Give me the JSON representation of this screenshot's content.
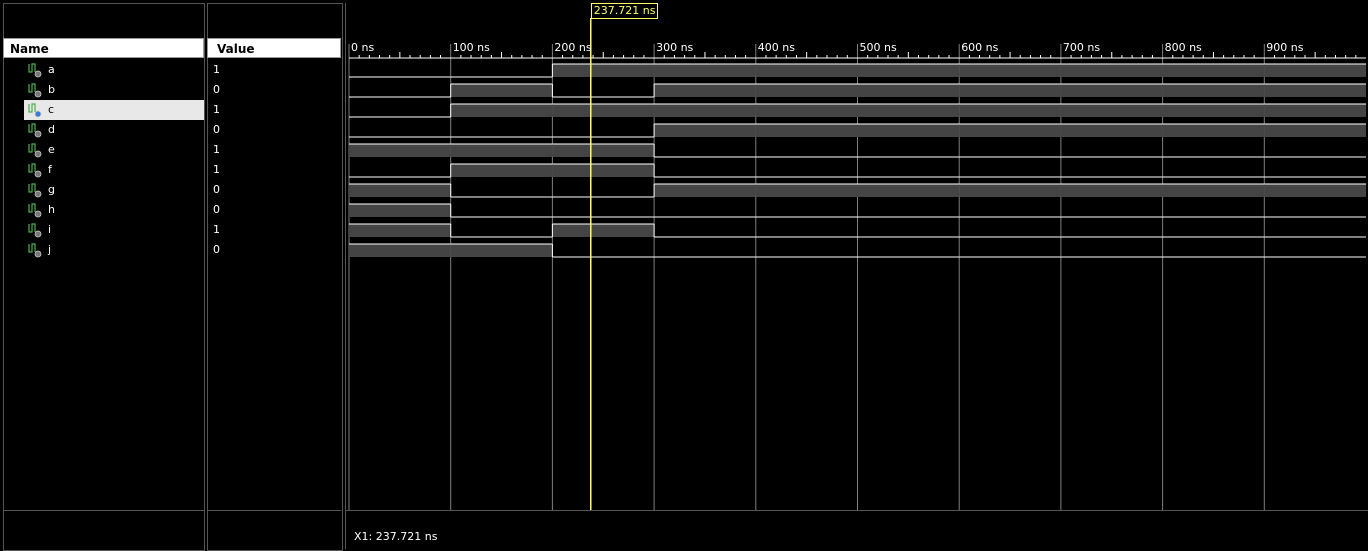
{
  "columns": {
    "name_header": "Name",
    "value_header": "Value"
  },
  "signals": [
    {
      "name": "a",
      "value": "1",
      "wave": [
        0,
        0,
        1,
        1,
        1,
        1,
        1,
        1,
        1,
        1
      ]
    },
    {
      "name": "b",
      "value": "0",
      "wave": [
        0,
        1,
        0,
        1,
        1,
        1,
        1,
        1,
        1,
        1
      ]
    },
    {
      "name": "c",
      "value": "1",
      "wave": [
        0,
        1,
        1,
        1,
        1,
        1,
        1,
        1,
        1,
        1
      ]
    },
    {
      "name": "d",
      "value": "0",
      "wave": [
        0,
        0,
        0,
        1,
        1,
        1,
        1,
        1,
        1,
        1
      ]
    },
    {
      "name": "e",
      "value": "1",
      "wave": [
        1,
        1,
        1,
        0,
        0,
        0,
        0,
        0,
        0,
        0
      ]
    },
    {
      "name": "f",
      "value": "1",
      "wave": [
        0,
        1,
        1,
        0,
        0,
        0,
        0,
        0,
        0,
        0
      ]
    },
    {
      "name": "g",
      "value": "0",
      "wave": [
        1,
        0,
        0,
        1,
        1,
        1,
        1,
        1,
        1,
        1
      ]
    },
    {
      "name": "h",
      "value": "0",
      "wave": [
        1,
        0,
        0,
        0,
        0,
        0,
        0,
        0,
        0,
        0
      ]
    },
    {
      "name": "i",
      "value": "1",
      "wave": [
        1,
        0,
        1,
        0,
        0,
        0,
        0,
        0,
        0,
        0
      ]
    },
    {
      "name": "j",
      "value": "0",
      "wave": [
        1,
        1,
        0,
        0,
        0,
        0,
        0,
        0,
        0,
        0
      ]
    }
  ],
  "selected_signal": "c",
  "timeline": {
    "ticks": [
      "0 ns",
      "100 ns",
      "200 ns",
      "300 ns",
      "400 ns",
      "500 ns",
      "600 ns",
      "700 ns",
      "800 ns",
      "900 ns"
    ],
    "start_ns": 0,
    "ns_per_division": 100
  },
  "cursor": {
    "time_ns": 237.721,
    "label": "237.721 ns"
  },
  "status_text": "X1: 237.721 ns",
  "colors": {
    "wave_high_fill": "#444444",
    "wave_line": "#ffffff",
    "cursor": "#ffff66",
    "grid": "#7f7f7f"
  }
}
